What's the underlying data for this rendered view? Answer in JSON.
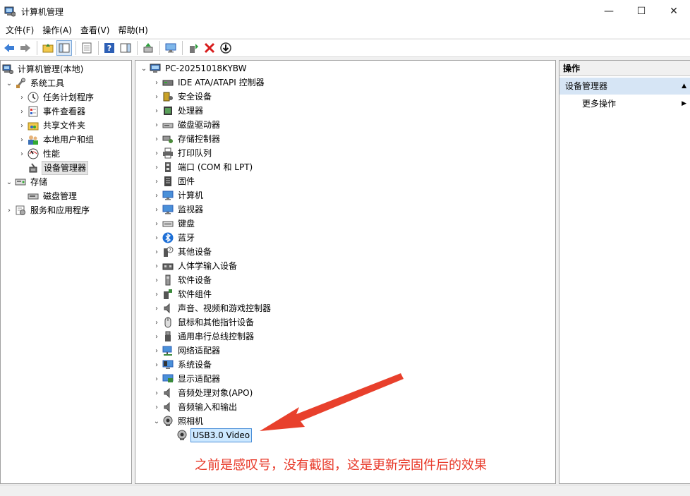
{
  "window": {
    "title": "计算机管理",
    "minimize": "—",
    "maximize": "☐",
    "close": "✕"
  },
  "menu": [
    "文件(F)",
    "操作(A)",
    "查看(V)",
    "帮助(H)"
  ],
  "left_tree": [
    {
      "label": "计算机管理(本地)",
      "icon": "computer-management-icon",
      "expander": "",
      "indent": 0
    },
    {
      "label": "系统工具",
      "icon": "system-tools-icon",
      "expander": "⌄",
      "indent": 1
    },
    {
      "label": "任务计划程序",
      "icon": "clock-icon",
      "expander": "›",
      "indent": 2
    },
    {
      "label": "事件查看器",
      "icon": "event-viewer-icon",
      "expander": "›",
      "indent": 2
    },
    {
      "label": "共享文件夹",
      "icon": "shared-folder-icon",
      "expander": "›",
      "indent": 2
    },
    {
      "label": "本地用户和组",
      "icon": "users-icon",
      "expander": "›",
      "indent": 2
    },
    {
      "label": "性能",
      "icon": "performance-icon",
      "expander": "›",
      "indent": 2
    },
    {
      "label": "设备管理器",
      "icon": "device-manager-icon",
      "expander": "",
      "indent": 2,
      "selected": true
    },
    {
      "label": "存储",
      "icon": "storage-icon",
      "expander": "⌄",
      "indent": 1
    },
    {
      "label": "磁盘管理",
      "icon": "disk-icon",
      "expander": "",
      "indent": 2
    },
    {
      "label": "服务和应用程序",
      "icon": "services-icon",
      "expander": "›",
      "indent": 1
    }
  ],
  "device_tree": {
    "root": "PC-20251018KYBW",
    "categories": [
      {
        "label": "IDE ATA/ATAPI 控制器",
        "icon": "ide-controller-icon"
      },
      {
        "label": "安全设备",
        "icon": "security-device-icon"
      },
      {
        "label": "处理器",
        "icon": "processor-icon"
      },
      {
        "label": "磁盘驱动器",
        "icon": "disk-drive-icon"
      },
      {
        "label": "存储控制器",
        "icon": "storage-controller-icon"
      },
      {
        "label": "打印队列",
        "icon": "printer-icon"
      },
      {
        "label": "端口 (COM 和 LPT)",
        "icon": "port-icon"
      },
      {
        "label": "固件",
        "icon": "firmware-icon"
      },
      {
        "label": "计算机",
        "icon": "monitor-icon"
      },
      {
        "label": "监视器",
        "icon": "monitor-icon"
      },
      {
        "label": "键盘",
        "icon": "keyboard-icon"
      },
      {
        "label": "蓝牙",
        "icon": "bluetooth-icon"
      },
      {
        "label": "其他设备",
        "icon": "other-device-icon"
      },
      {
        "label": "人体学输入设备",
        "icon": "hid-icon"
      },
      {
        "label": "软件设备",
        "icon": "software-device-icon"
      },
      {
        "label": "软件组件",
        "icon": "software-component-icon"
      },
      {
        "label": "声音、视频和游戏控制器",
        "icon": "speaker-icon"
      },
      {
        "label": "鼠标和其他指针设备",
        "icon": "mouse-icon"
      },
      {
        "label": "通用串行总线控制器",
        "icon": "usb-icon"
      },
      {
        "label": "网络适配器",
        "icon": "network-adapter-icon"
      },
      {
        "label": "系统设备",
        "icon": "system-device-icon"
      },
      {
        "label": "显示适配器",
        "icon": "display-adapter-icon"
      },
      {
        "label": "音频处理对象(APO)",
        "icon": "speaker-icon"
      },
      {
        "label": "音频输入和输出",
        "icon": "speaker-icon"
      },
      {
        "label": "照相机",
        "icon": "camera-icon",
        "expanded": true
      }
    ],
    "camera_child": "USB3.0 Video"
  },
  "actions": {
    "header": "操作",
    "section": "设备管理器",
    "more": "更多操作"
  },
  "annotation": {
    "text": "之前是感叹号，没有截图，这是更新完固件后的效果",
    "color": "#e83a2a"
  }
}
